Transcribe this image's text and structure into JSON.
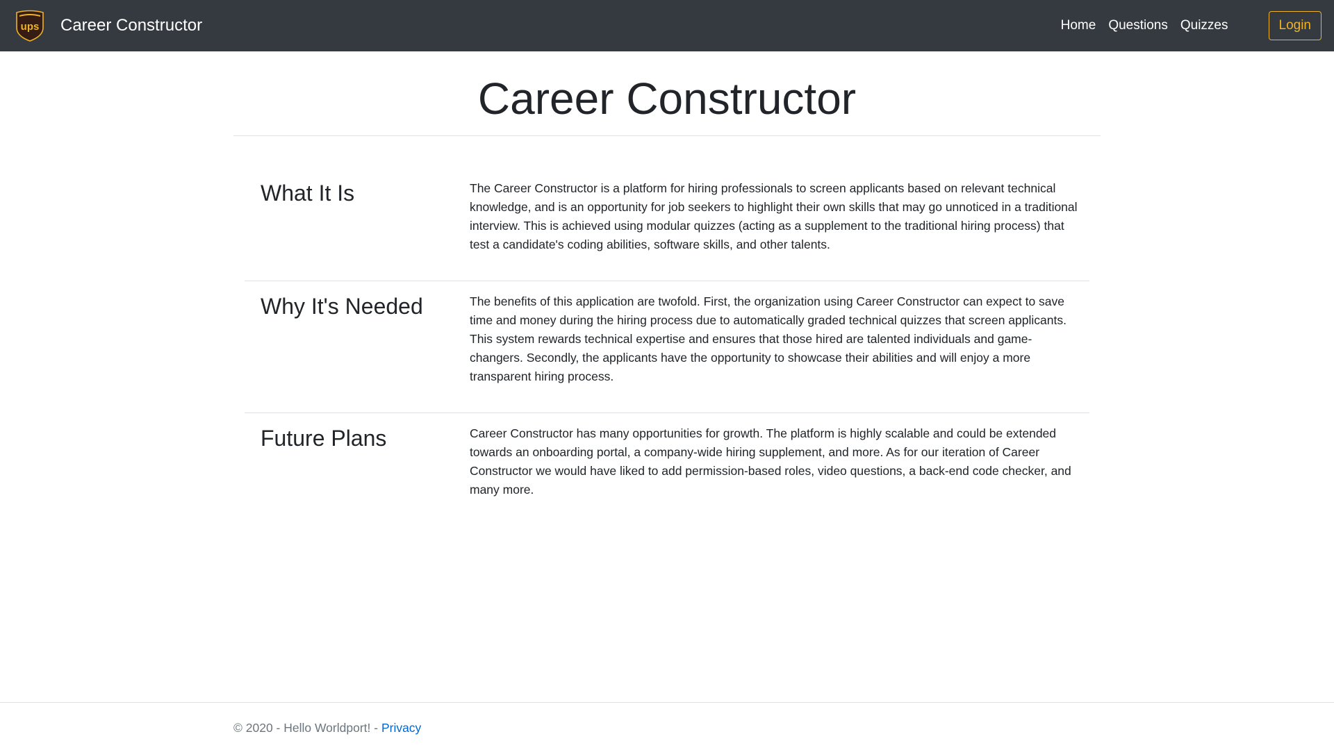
{
  "navbar": {
    "brand": "Career Constructor",
    "logo_text": "ups",
    "logo_icon": "ups-shield-logo",
    "links": [
      "Home",
      "Questions",
      "Quizzes"
    ],
    "login": "Login"
  },
  "main": {
    "title": "Career Constructor",
    "sections": [
      {
        "heading": "What It Is",
        "body": "The Career Constructor is a platform for hiring professionals to screen applicants based on relevant technical knowledge, and is an opportunity for job seekers to highlight their own skills that may go unnoticed in a traditional interview. This is achieved using modular quizzes (acting as a supplement to the traditional hiring process) that test a candidate's coding abilities, software skills, and other talents."
      },
      {
        "heading": "Why It's Needed",
        "body": "The benefits of this application are twofold. First, the organization using Career Constructor can expect to save time and money during the hiring process due to automatically graded technical quizzes that screen applicants. This system rewards technical expertise and ensures that those hired are talented individuals and game-changers. Secondly, the applicants have the opportunity to showcase their abilities and will enjoy a more transparent hiring process."
      },
      {
        "heading": "Future Plans",
        "body": "Career Constructor has many opportunities for growth. The platform is highly scalable and could be extended towards an onboarding portal, a company-wide hiring supplement, and more. As for our iteration of Career Constructor we would have liked to add permission-based roles, video questions, a back-end code checker, and many more."
      }
    ]
  },
  "footer": {
    "text": "© 2020 - Hello Worldport! - ",
    "privacy": "Privacy"
  },
  "colors": {
    "navbar_bg": "#343a40",
    "accent": "#f0b323",
    "link": "#0366d6",
    "logo_brown": "#351c15"
  }
}
